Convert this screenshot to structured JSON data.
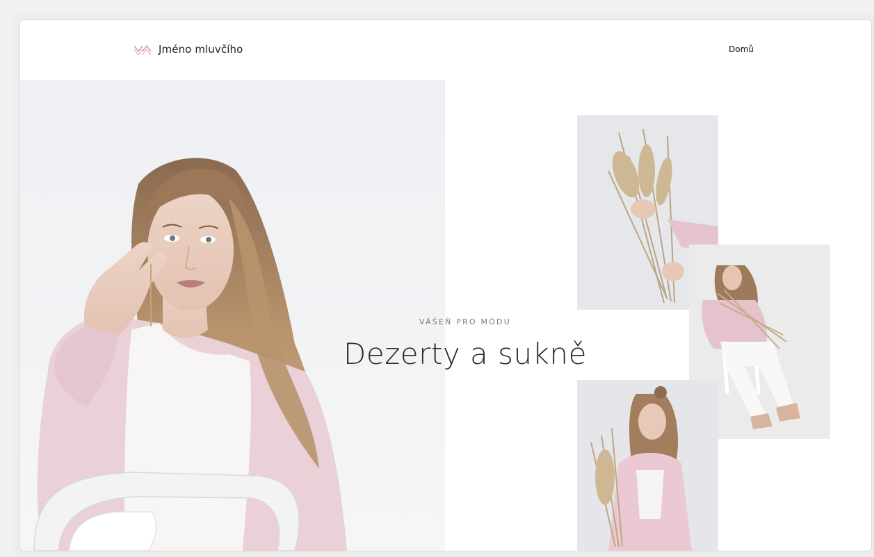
{
  "header": {
    "logo_text": "Jméno mluvčího",
    "logo_icon": "double-chevron-icon",
    "nav": [
      {
        "label": "Domů"
      }
    ]
  },
  "hero": {
    "eyebrow": "VÁŠEŇ PRO MÓDU",
    "title": "Dezerty a sukně"
  },
  "colors": {
    "accent": "#c98f8a",
    "sweater_pink": "#e9c9d1",
    "hair": "#b89068",
    "background": "#f1f2f4"
  }
}
